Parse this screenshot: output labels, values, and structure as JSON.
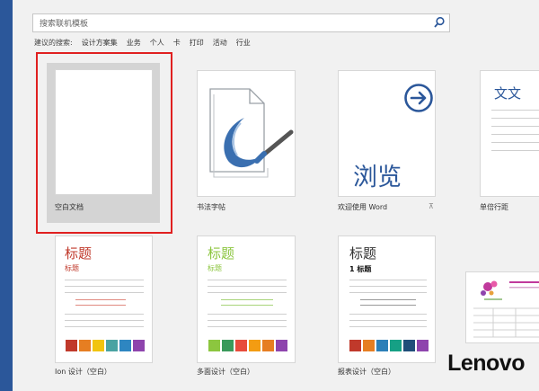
{
  "search": {
    "placeholder": "搜索联机模板",
    "suggest_lead": "建议的搜索:",
    "suggestions": [
      "设计方案集",
      "业务",
      "个人",
      "卡",
      "打印",
      "活动",
      "行业"
    ]
  },
  "templates": [
    {
      "label": "空白文档"
    },
    {
      "label": "书法字帖"
    },
    {
      "label": "欢迎使用 Word",
      "thumb_text": "浏览"
    },
    {
      "label": "单倍行距",
      "thumb_text": "文文"
    },
    {
      "label": "Ion 设计（空白）",
      "title": "标题",
      "subtitle": "标题"
    },
    {
      "label": "多面设计（空白）",
      "title": "标题",
      "subtitle": "标题"
    },
    {
      "label": "报表设计（空白）",
      "title": "标题",
      "subtitle": "1 标题"
    }
  ],
  "brand": "Lenovo",
  "colors": {
    "accent": "#2b579a",
    "selection": "#e02020",
    "ion_red": "#c0392b",
    "facet_green": "#8cc63f"
  }
}
